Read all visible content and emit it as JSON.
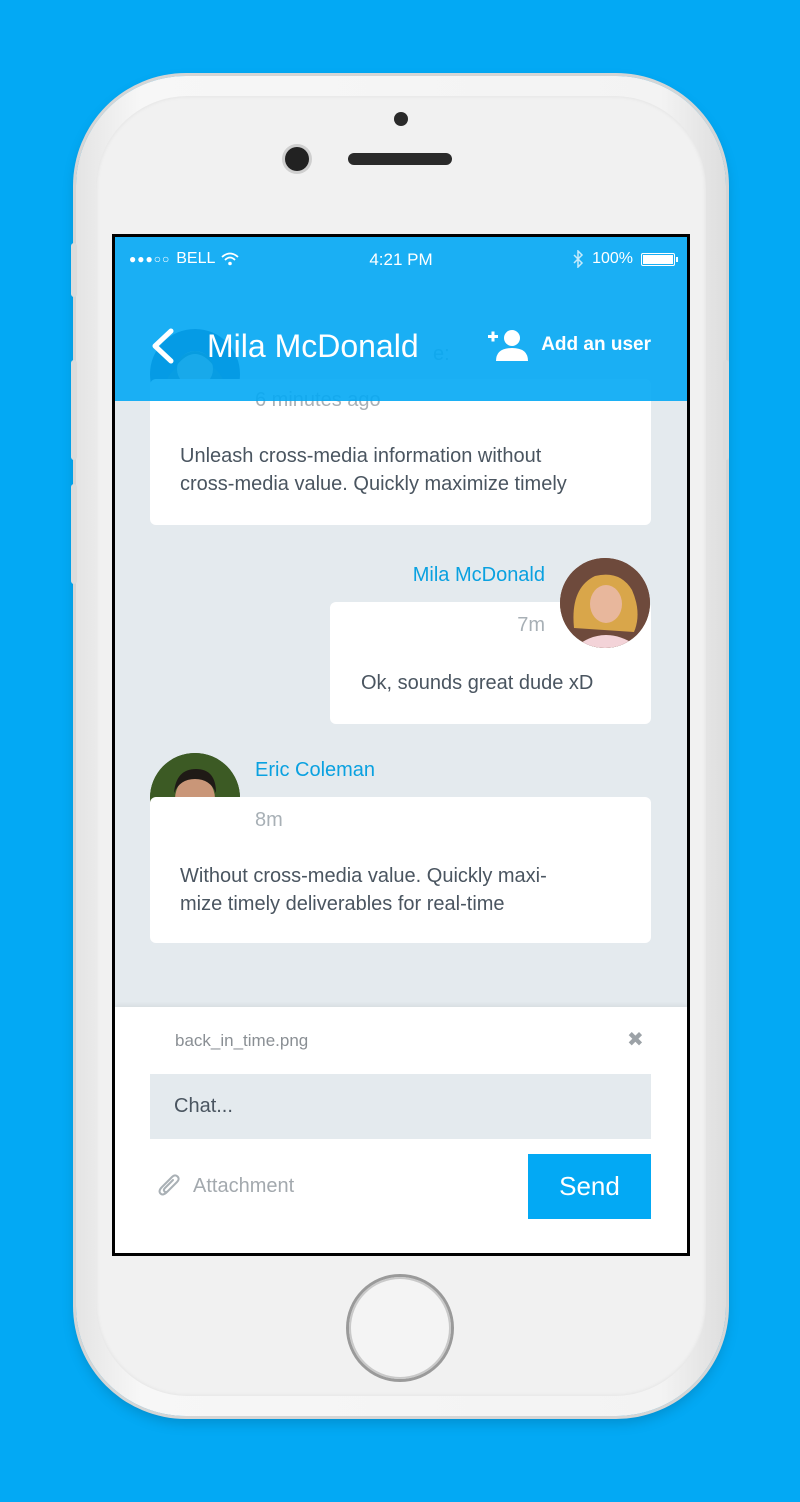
{
  "status_bar": {
    "signal_dots": "●●●○○",
    "carrier": "BELL",
    "time": "4:21 PM",
    "battery": "100%"
  },
  "header": {
    "title": "Mila McDonald",
    "add_user_label": "Add an user"
  },
  "messages": [
    {
      "partial_header": "e:",
      "time": "6 minutes ago",
      "text_lines": [
        "Unleash cross-media information without",
        "cross-media value. Quickly maximize timely"
      ]
    },
    {
      "author": "Mila McDonald",
      "time": "7m",
      "text": "Ok, sounds great dude xD"
    },
    {
      "author": "Eric Coleman",
      "time": "8m",
      "text_lines": [
        "Without cross-media value. Quickly maxi-",
        "mize timely deliverables for real-time"
      ]
    }
  ],
  "composer": {
    "attachment_file": "back_in_time.png",
    "input_placeholder": "Chat...",
    "attachment_label": "Attachment",
    "send_label": "Send"
  },
  "colors": {
    "accent": "#03a9f4",
    "name_text": "#0aa1e0",
    "chat_background": "#e4eaee"
  }
}
